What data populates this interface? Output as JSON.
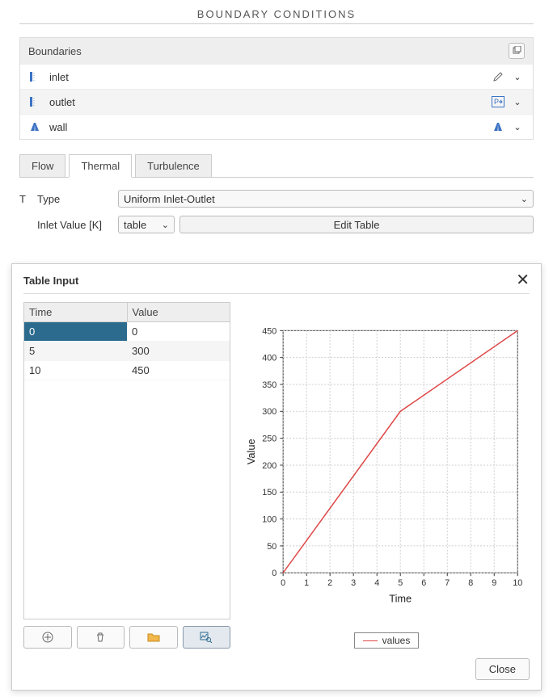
{
  "title": "BOUNDARY CONDITIONS",
  "boundaries": {
    "header": "Boundaries",
    "items": [
      {
        "label": "inlet"
      },
      {
        "label": "outlet"
      },
      {
        "label": "wall"
      }
    ]
  },
  "tabs": {
    "flow": "Flow",
    "thermal": "Thermal",
    "turbulence": "Turbulence"
  },
  "form": {
    "T": "T",
    "type_label": "Type",
    "type_value": "Uniform Inlet-Outlet",
    "inlet_label": "Inlet Value [K]",
    "inlet_mode": "table",
    "edit_table": "Edit Table"
  },
  "dialog": {
    "title": "Table Input",
    "close": "Close",
    "columns": {
      "time": "Time",
      "value": "Value"
    },
    "rows": [
      {
        "time": "0",
        "value": "0"
      },
      {
        "time": "5",
        "value": "300"
      },
      {
        "time": "10",
        "value": "450"
      }
    ],
    "legend": "values",
    "xlabel": "Time",
    "ylabel": "Value"
  },
  "chart_data": {
    "type": "line",
    "title": "",
    "xlabel": "Time",
    "ylabel": "Value",
    "xlim": [
      0,
      10
    ],
    "ylim": [
      0,
      450
    ],
    "xticks": [
      0,
      1,
      2,
      3,
      4,
      5,
      6,
      7,
      8,
      9,
      10
    ],
    "yticks": [
      0,
      50,
      100,
      150,
      200,
      250,
      300,
      350,
      400,
      450
    ],
    "grid": true,
    "series": [
      {
        "name": "values",
        "x": [
          0,
          5,
          10
        ],
        "y": [
          0,
          300,
          450
        ],
        "color": "#d44"
      }
    ]
  }
}
